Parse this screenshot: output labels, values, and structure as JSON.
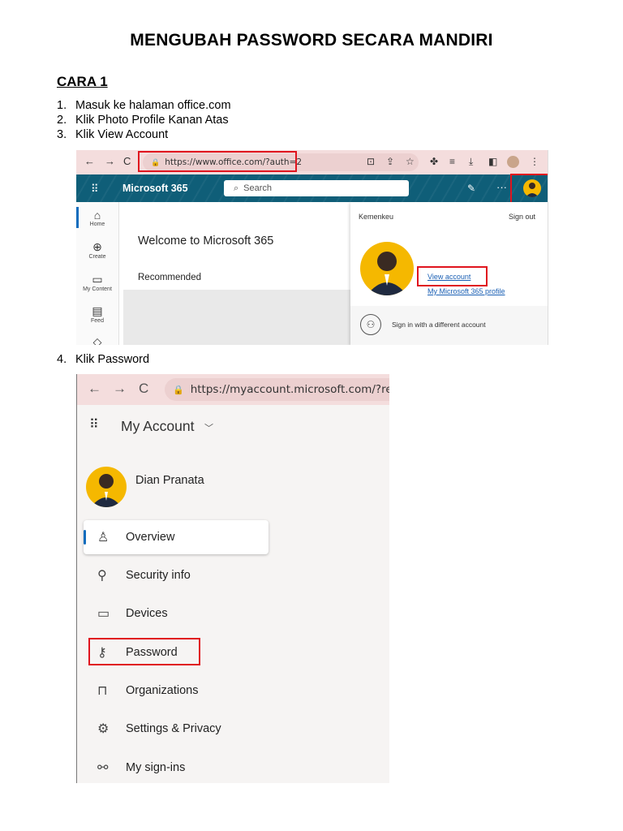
{
  "document": {
    "title": "MENGUBAH PASSWORD SECARA MANDIRI",
    "section": "CARA 1",
    "steps": [
      {
        "num": "1.",
        "text": "Masuk ke halaman office.com"
      },
      {
        "num": "2.",
        "text": "Klik Photo Profile Kanan Atas"
      },
      {
        "num": "3.",
        "text": "Klik View Account"
      },
      {
        "num": "4.",
        "text": "Klik Password"
      }
    ]
  },
  "screenshot1": {
    "url": "https://www.office.com/?auth=2",
    "app_name": "Microsoft 365",
    "search_placeholder": "Search",
    "rail": [
      {
        "label": "Home",
        "icon": "home-icon"
      },
      {
        "label": "Create",
        "icon": "plus-icon"
      },
      {
        "label": "My Content",
        "icon": "folder-icon"
      },
      {
        "label": "Feed",
        "icon": "feed-icon"
      }
    ],
    "welcome": "Welcome to Microsoft 365",
    "recommended": "Recommended",
    "account_panel": {
      "org": "Kemenkeu",
      "sign_out": "Sign out",
      "view_account": "View account",
      "profile_link": "My Microsoft 365 profile",
      "different_account": "Sign in with a different account"
    },
    "highlight_color": "#e0141e"
  },
  "screenshot2": {
    "url": "https://myaccount.microsoft.com/?ref=M",
    "app_name": "My Account",
    "user_name": "Dian Pranata",
    "nav": [
      {
        "label": "Overview",
        "icon": "person-icon"
      },
      {
        "label": "Security info",
        "icon": "security-info-icon"
      },
      {
        "label": "Devices",
        "icon": "laptop-icon"
      },
      {
        "label": "Password",
        "icon": "key-icon"
      },
      {
        "label": "Organizations",
        "icon": "briefcase-icon"
      },
      {
        "label": "Settings & Privacy",
        "icon": "gear-icon"
      },
      {
        "label": "My sign-ins",
        "icon": "sign-ins-icon"
      }
    ],
    "accent_color": "#0f6cbd"
  }
}
